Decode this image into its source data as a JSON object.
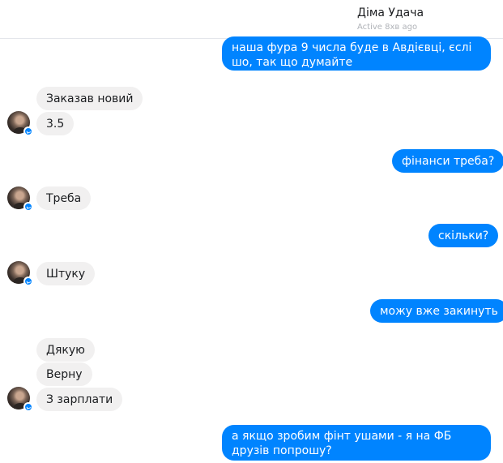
{
  "header": {
    "contact_name": "Діма Удача",
    "status": "Active 8хв ago"
  },
  "messages": [
    {
      "direction": "out",
      "text": "наша фура 9 числа буде в Авдієвці, єслі шо, так що думайте"
    },
    {
      "direction": "in",
      "text": "Заказав новий"
    },
    {
      "direction": "in",
      "text": "3.5"
    },
    {
      "direction": "out",
      "text": "фінанси треба?"
    },
    {
      "direction": "in",
      "text": "Треба"
    },
    {
      "direction": "out",
      "text": "скільки?"
    },
    {
      "direction": "in",
      "text": "Штуку"
    },
    {
      "direction": "out",
      "text": "можу вже закинуть"
    },
    {
      "direction": "in",
      "text": "Дякую"
    },
    {
      "direction": "in",
      "text": "Верну"
    },
    {
      "direction": "in",
      "text": "З зарплати"
    },
    {
      "direction": "out",
      "text": "а якщо зробим фінт ушами - я на ФБ друзів попрошу?"
    }
  ],
  "colors": {
    "outgoing_bubble": "#0084ff",
    "incoming_bubble": "#f1f0f0",
    "status_text": "#b0b3b8"
  },
  "icons": {
    "avatar": "contact-avatar",
    "messenger_badge": "messenger-badge-icon"
  }
}
